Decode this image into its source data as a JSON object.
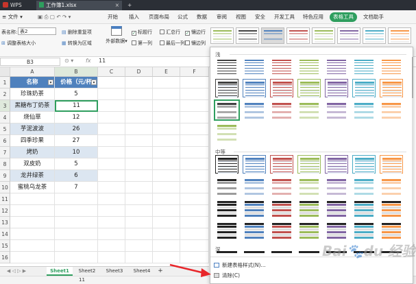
{
  "titlebar": {
    "app_tab": "WPS",
    "file_tab": "工作簿1.xlsx"
  },
  "menubar": {
    "file_label": "文件",
    "items": [
      "开始",
      "插入",
      "页面布局",
      "公式",
      "数据",
      "审阅",
      "视图",
      "安全",
      "开发工具",
      "特色应用",
      "表格工具",
      "文档助手"
    ],
    "active_index": 10
  },
  "ribbon": {
    "table_name_label": "表名称:",
    "table_name_value": "表2",
    "resize_label": "调整表格大小",
    "remove_dup_label": "删除重复项",
    "convert_label": "转换为区域",
    "external_label": "外部数据",
    "opt_header": "标题行",
    "opt_total": "汇总行",
    "opt_banded_rows": "镶边行",
    "opt_first_col": "第一列",
    "opt_last_col": "最后一列",
    "opt_banded_cols": "镶边列"
  },
  "formulabar": {
    "cell_ref": "B3",
    "fx": "fx",
    "value": "11"
  },
  "grid": {
    "columns": [
      "A",
      "B",
      "C",
      "D",
      "E",
      "F"
    ],
    "rows": [
      "1",
      "2",
      "3",
      "4",
      "5",
      "6",
      "7",
      "8",
      "9",
      "10",
      "11",
      "12",
      "13",
      "14",
      "15",
      "16"
    ],
    "header": [
      "名称",
      "价格（元/杯"
    ],
    "data": [
      [
        "珍珠奶茶",
        "5"
      ],
      [
        "黑糖布丁奶茶",
        "11"
      ],
      [
        "烧仙草",
        "12"
      ],
      [
        "芋泥波波",
        "26"
      ],
      [
        "四季珍果",
        "27"
      ],
      [
        "烤奶",
        "10"
      ],
      [
        "双皮奶",
        "5"
      ],
      [
        "龙井绿茶",
        "6"
      ],
      [
        "蜜桃乌龙茶",
        "7"
      ]
    ]
  },
  "sheets": {
    "tabs": [
      "Sheet1",
      "Sheet2",
      "Sheet3",
      "Sheet4"
    ],
    "active": 0,
    "add": "+"
  },
  "statusbar": {
    "value": "11"
  },
  "dropdown": {
    "light_label": "浅",
    "medium_label": "中等",
    "dark_label": "深",
    "new_style": "新建表格样式(N)...",
    "clear": "清除(C)"
  },
  "colors": {
    "header_blue": "#4f81bd",
    "band_blue": "#dce6f1",
    "accent_green": "#2e9e5e",
    "arrow_red": "#e8262a"
  },
  "watermark": "Baidu 经验"
}
